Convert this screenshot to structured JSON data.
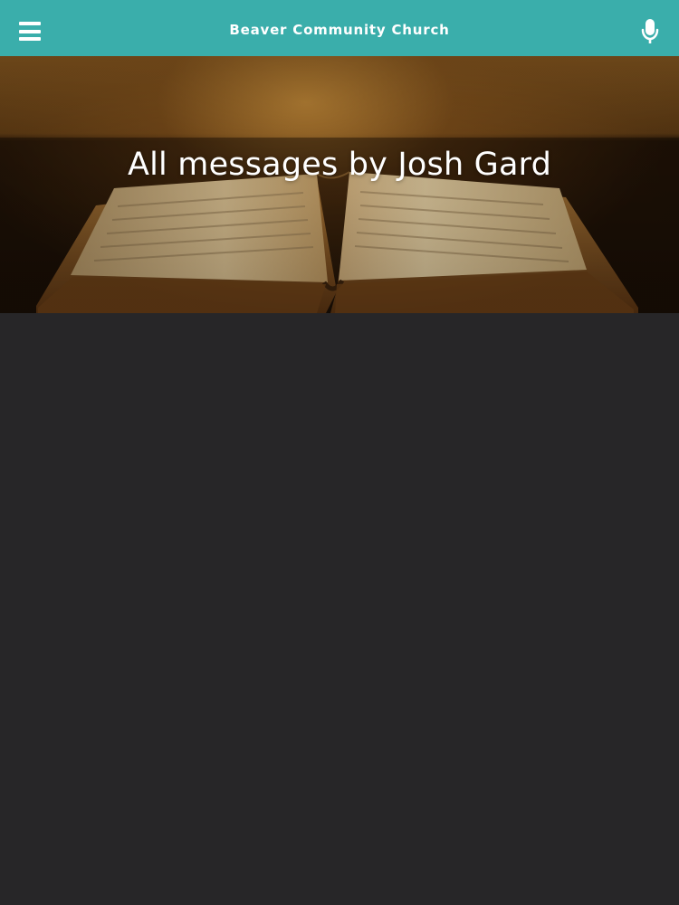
{
  "header": {
    "title": "Beaver Community Church",
    "menu_icon": "hamburger-menu-icon",
    "mic_icon": "microphone-icon",
    "background_color": "#3aaeab"
  },
  "hero": {
    "heading": "All messages by Josh Gard",
    "image_subject": "open-bible-image"
  },
  "content": {
    "background_color": "#272628"
  }
}
